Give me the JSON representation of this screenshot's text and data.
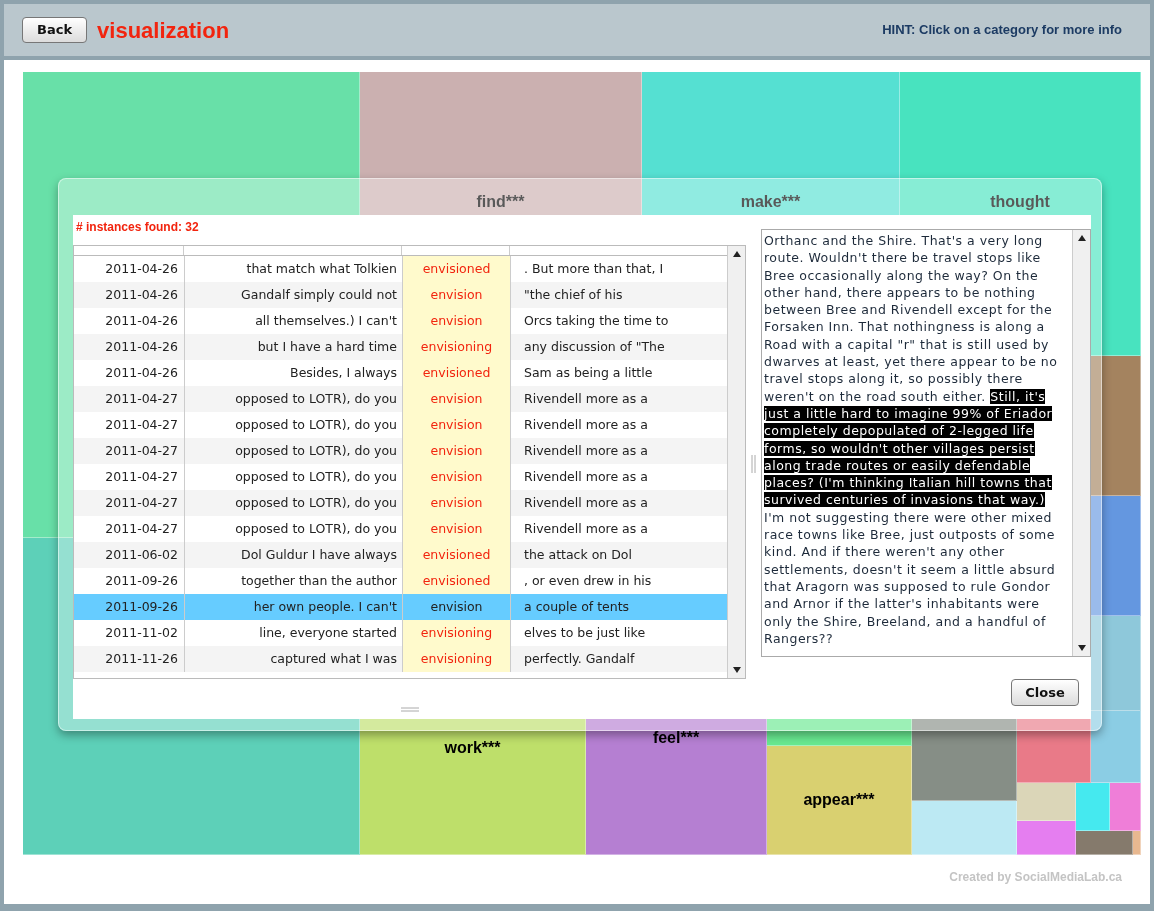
{
  "header": {
    "back_button": "Back",
    "title": "visualization",
    "hint": "HINT: Click on a category for more info"
  },
  "treemap": {
    "tiles": [
      {
        "color": "#68e0a8"
      },
      {
        "color": "#5dd0b8"
      },
      {
        "label": "find***",
        "color": "#cbb0b0"
      },
      {
        "label": "make***",
        "color": "#55e0d2"
      },
      {
        "label": "thought",
        "color": "#48e3bf"
      },
      {
        "color": "#a4835f"
      },
      {
        "color": "#6497e0"
      },
      {
        "color": "#8ec8da"
      },
      {
        "color": "#8bcde4"
      },
      {
        "label": "work***",
        "color": "#bedf6a"
      },
      {
        "label": "feel***",
        "color": "#b57fd2"
      },
      {
        "color": "#68e890"
      },
      {
        "label": "appear***",
        "color": "#d9d070"
      },
      {
        "color": "#868e86"
      },
      {
        "color": "#bce9f3"
      },
      {
        "color": "#e97a88"
      },
      {
        "color": "#dbd6b8"
      },
      {
        "color": "#e57ef0"
      },
      {
        "color": "#45e9ef"
      },
      {
        "color": "#ef7ed8"
      },
      {
        "color": "#857a6c"
      },
      {
        "color": "#e8b890"
      }
    ]
  },
  "dialog": {
    "count_label": "# instances found: 32",
    "rows": [
      {
        "date": "2011-04-26",
        "before": "that match what Tolkien",
        "keyword": "envisioned",
        "after": ". But more than that, I",
        "selected": false
      },
      {
        "date": "2011-04-26",
        "before": "Gandalf simply could not",
        "keyword": "envision",
        "after": "\"the chief of his",
        "selected": false
      },
      {
        "date": "2011-04-26",
        "before": "all themselves.) I can't",
        "keyword": "envision",
        "after": "Orcs taking the time to",
        "selected": false
      },
      {
        "date": "2011-04-26",
        "before": "but I have a hard time",
        "keyword": "envisioning",
        "after": "any discussion of \"The",
        "selected": false
      },
      {
        "date": "2011-04-26",
        "before": "Besides, I always",
        "keyword": "envisioned",
        "after": "Sam as being a little",
        "selected": false
      },
      {
        "date": "2011-04-27",
        "before": "opposed to LOTR), do you",
        "keyword": "envision",
        "after": "Rivendell more as a",
        "selected": false
      },
      {
        "date": "2011-04-27",
        "before": "opposed to LOTR), do you",
        "keyword": "envision",
        "after": "Rivendell more as a",
        "selected": false
      },
      {
        "date": "2011-04-27",
        "before": "opposed to LOTR), do you",
        "keyword": "envision",
        "after": "Rivendell more as a",
        "selected": false
      },
      {
        "date": "2011-04-27",
        "before": "opposed to LOTR), do you",
        "keyword": "envision",
        "after": "Rivendell more as a",
        "selected": false
      },
      {
        "date": "2011-04-27",
        "before": "opposed to LOTR), do you",
        "keyword": "envision",
        "after": "Rivendell more as a",
        "selected": false
      },
      {
        "date": "2011-04-27",
        "before": "opposed to LOTR), do you",
        "keyword": "envision",
        "after": "Rivendell more as a",
        "selected": false
      },
      {
        "date": "2011-06-02",
        "before": "Dol Guldur I have always",
        "keyword": "envisioned",
        "after": "the attack on Dol",
        "selected": false
      },
      {
        "date": "2011-09-26",
        "before": "together than the author",
        "keyword": "envisioned",
        "after": ", or even drew in his",
        "selected": false
      },
      {
        "date": "2011-09-26",
        "before": "her own people. I can't",
        "keyword": "envision",
        "after": "a couple of tents",
        "selected": true
      },
      {
        "date": "2011-11-02",
        "before": "line, everyone started",
        "keyword": "envisioning",
        "after": "elves to be just like",
        "selected": false
      },
      {
        "date": "2011-11-26",
        "before": "captured what I was",
        "keyword": "envisioning",
        "after": "perfectly. Gandalf",
        "selected": false
      }
    ],
    "passage": {
      "text_before": "Orthanc and the Shire. That's a very long route. Wouldn't there be travel stops like Bree occasionally along the way? On the other hand, there appears to be nothing between Bree and Rivendell except for the Forsaken Inn. That nothingness is along a Road with a capital \"r\" that is still used by dwarves at least, yet there appear to be no travel stops along it, so possibly there weren't on the road south either. ",
      "highlighted": "Still, it's just a little hard to imagine 99% of Eriador completely depopulated of 2-legged life forms, so wouldn't other villages persist along trade routes or easily defendable places? (I'm thinking Italian hill towns that survived centuries of invasions that way.)",
      "text_after": " I'm not suggesting there were other mixed race towns like Bree, just outposts of some kind. And if there weren't any other settlements, doesn't it seem a little absurd that Aragorn was supposed to rule Gondor and Arnor if the latter's inhabitants were only the Shire, Breeland, and a handful of Rangers??"
    },
    "close_button": "Close"
  },
  "footer": "Created by SocialMediaLab.ca"
}
